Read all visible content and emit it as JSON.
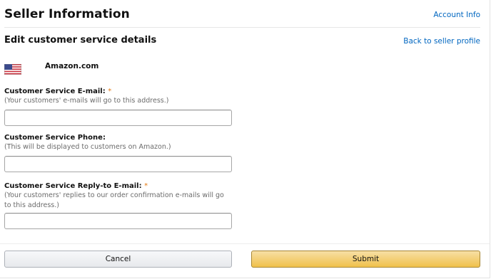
{
  "header": {
    "title": "Seller Information",
    "account_link": "Account Info"
  },
  "section": {
    "title": "Edit customer service details",
    "back_link": "Back to seller profile"
  },
  "marketplace": {
    "flag_icon": "us-flag-icon",
    "name": "Amazon.com"
  },
  "fields": {
    "email": {
      "label": "Customer Service E-mail:",
      "required_mark": "*",
      "help": "(Your customers' e-mails will go to this address.)",
      "value": ""
    },
    "phone": {
      "label": "Customer Service Phone:",
      "help": "(This will be displayed to customers on Amazon.)",
      "value": ""
    },
    "reply_to": {
      "label": "Customer Service Reply-to E-mail:",
      "required_mark": "*",
      "help": "(Your customers' replies to our order confirmation e-mails will go to this address.)",
      "value": ""
    }
  },
  "buttons": {
    "cancel": "Cancel",
    "submit": "Submit"
  },
  "colors": {
    "link": "#0066c0",
    "required": "#e47911",
    "submit_bg": "#f0c14b"
  }
}
